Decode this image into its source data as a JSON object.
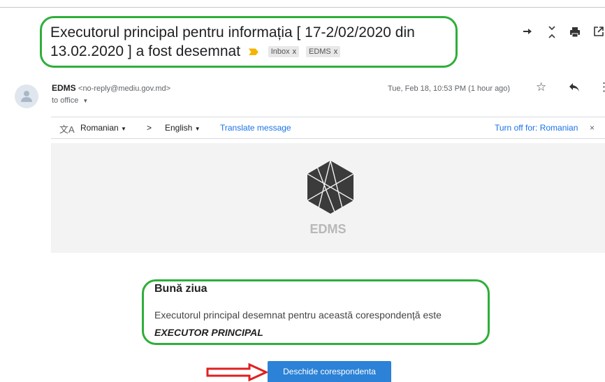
{
  "subject": {
    "title": "Executorul principal pentru informația [ 17-2/02/2020 din 13.02.2020 ] a fost desemnat",
    "labels": [
      {
        "name": "Inbox",
        "close": "x"
      },
      {
        "name": "EDMS",
        "close": "x"
      }
    ]
  },
  "toolbar": {
    "forward_icon": "arrow-right-icon",
    "collapse_icon": "collapse-icon",
    "print_icon": "print-icon",
    "open_icon": "open-new-window-icon"
  },
  "message": {
    "sender_name": "EDMS",
    "sender_email": "<no-reply@mediu.gov.md>",
    "to": "to office",
    "date": "Tue, Feb 18, 10:53 PM (1 hour ago)"
  },
  "translate": {
    "from_lang": "Romanian",
    "separator": ">",
    "to_lang": "English",
    "translate_link": "Translate message",
    "turn_off": "Turn off for: Romanian",
    "close": "×"
  },
  "email_body": {
    "brand": "EDMS",
    "greeting": "Bună ziua",
    "text": "Executorul principal desemnat pentru această corespondență este",
    "executor": "EXECUTOR PRINCIPAL",
    "button": "Deschide corespondenta"
  },
  "colors": {
    "highlight_box": "#2fae3a",
    "annotation_arrow": "#e02020",
    "cta_button": "#2c82d6",
    "link": "#1a73e8"
  }
}
